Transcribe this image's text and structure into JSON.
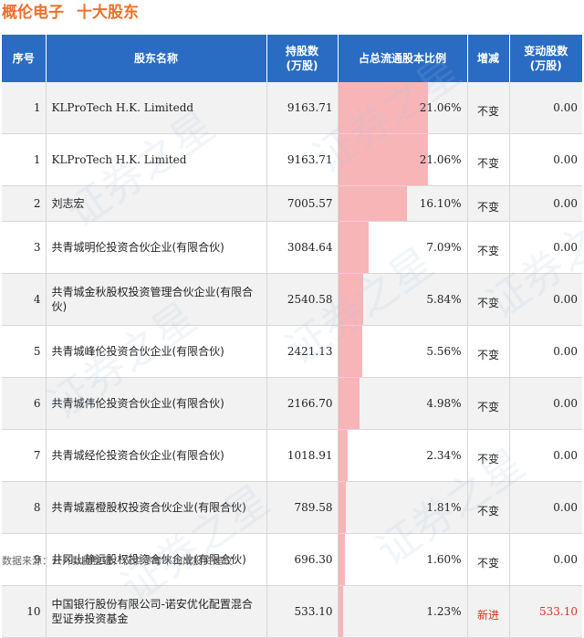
{
  "header": {
    "company": "概伦电子",
    "subtitle": "十大股东"
  },
  "columns": {
    "rank": "序号",
    "name": "股东名称",
    "shares": "持股数\n(万股)",
    "ratio": "占总流通股本比例",
    "change_type": "增减",
    "change_amount": "变动股数\n(万股)"
  },
  "rows": [
    {
      "rank": "1",
      "name": "KLProTech H.K. Limitedd",
      "shares": "9163.71",
      "ratio": 21.06,
      "ratio_text": "21.06%",
      "change_type": "不变",
      "change_amount": "0.00"
    },
    {
      "rank": "1",
      "name": "KLProTech H.K. Limited",
      "shares": "9163.71",
      "ratio": 21.06,
      "ratio_text": "21.06%",
      "change_type": "不变",
      "change_amount": "0.00"
    },
    {
      "rank": "2",
      "name": "刘志宏",
      "shares": "7005.57",
      "ratio": 16.1,
      "ratio_text": "16.10%",
      "change_type": "不变",
      "change_amount": "0.00"
    },
    {
      "rank": "3",
      "name": "共青城明伦投资合伙企业(有限合伙)",
      "shares": "3084.64",
      "ratio": 7.09,
      "ratio_text": "7.09%",
      "change_type": "不变",
      "change_amount": "0.00"
    },
    {
      "rank": "4",
      "name": "共青城金秋股权投资管理合伙企业(有限合伙)",
      "shares": "2540.58",
      "ratio": 5.84,
      "ratio_text": "5.84%",
      "change_type": "不变",
      "change_amount": "0.00"
    },
    {
      "rank": "5",
      "name": "共青城峰伦投资合伙企业(有限合伙)",
      "shares": "2421.13",
      "ratio": 5.56,
      "ratio_text": "5.56%",
      "change_type": "不变",
      "change_amount": "0.00"
    },
    {
      "rank": "6",
      "name": "共青城伟伦投资合伙企业(有限合伙)",
      "shares": "2166.70",
      "ratio": 4.98,
      "ratio_text": "4.98%",
      "change_type": "不变",
      "change_amount": "0.00"
    },
    {
      "rank": "7",
      "name": "共青城经伦投资合伙企业(有限合伙)",
      "shares": "1018.91",
      "ratio": 2.34,
      "ratio_text": "2.34%",
      "change_type": "不变",
      "change_amount": "0.00"
    },
    {
      "rank": "8",
      "name": "共青城嘉橙股权投资合伙企业(有限合伙)",
      "shares": "789.58",
      "ratio": 1.81,
      "ratio_text": "1.81%",
      "change_type": "不变",
      "change_amount": "0.00"
    },
    {
      "rank": "9",
      "name": "井冈山静远股权投资合伙企业(有限合伙)",
      "shares": "696.30",
      "ratio": 1.6,
      "ratio_text": "1.60%",
      "change_type": "不变",
      "change_amount": "0.00"
    },
    {
      "rank": "10",
      "name": "中国银行股份有限公司-诺安优化配置混合型证券投资基金",
      "shares": "533.10",
      "ratio": 1.23,
      "ratio_text": "1.23%",
      "change_type": "新进",
      "change_amount": "533.10"
    }
  ],
  "ratio_bar_max": 30,
  "colors": {
    "title": "#ef6f2b",
    "header_bg": "#2a6cc4",
    "bar": "#f7b5b8",
    "new_entry": "#e0301e"
  },
  "footer": {
    "source": "数据来源：公开数据整理，仅供参考不构成投资建议"
  },
  "watermark": "证券之星"
}
